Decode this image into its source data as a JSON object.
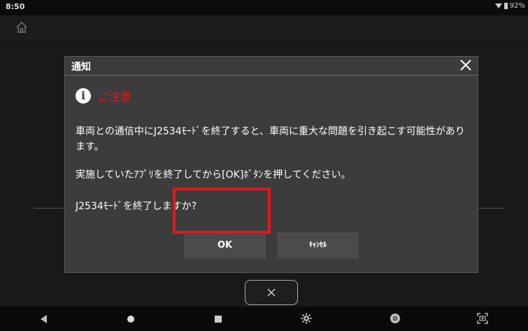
{
  "status": {
    "time": "8:50",
    "battery": "92%"
  },
  "dialog": {
    "title": "通知",
    "caution": "ご注意",
    "message1": "車両との通信中にJ2534ﾓｰﾄﾞを終了すると、車両に重大な問題を引き起こす可能性があります。",
    "message2": "実施していたｱﾌﾟﾘを終了してから[OK]ﾎﾞﾀﾝを押してください。",
    "question": "J2534ﾓｰﾄﾞを終了しますか?",
    "ok_label": "OK",
    "cancel_label": "ｷｬﾝｾﾙ"
  },
  "colors": {
    "accent": "#e8151b",
    "dialog_bg": "#3c3c3c",
    "button_bg": "#4b4b4b"
  },
  "icons": [
    "home-icon",
    "close-icon",
    "info-icon",
    "back-icon",
    "home-circle-icon",
    "recents-icon",
    "gear-icon",
    "browser-icon",
    "screenshot-icon"
  ]
}
